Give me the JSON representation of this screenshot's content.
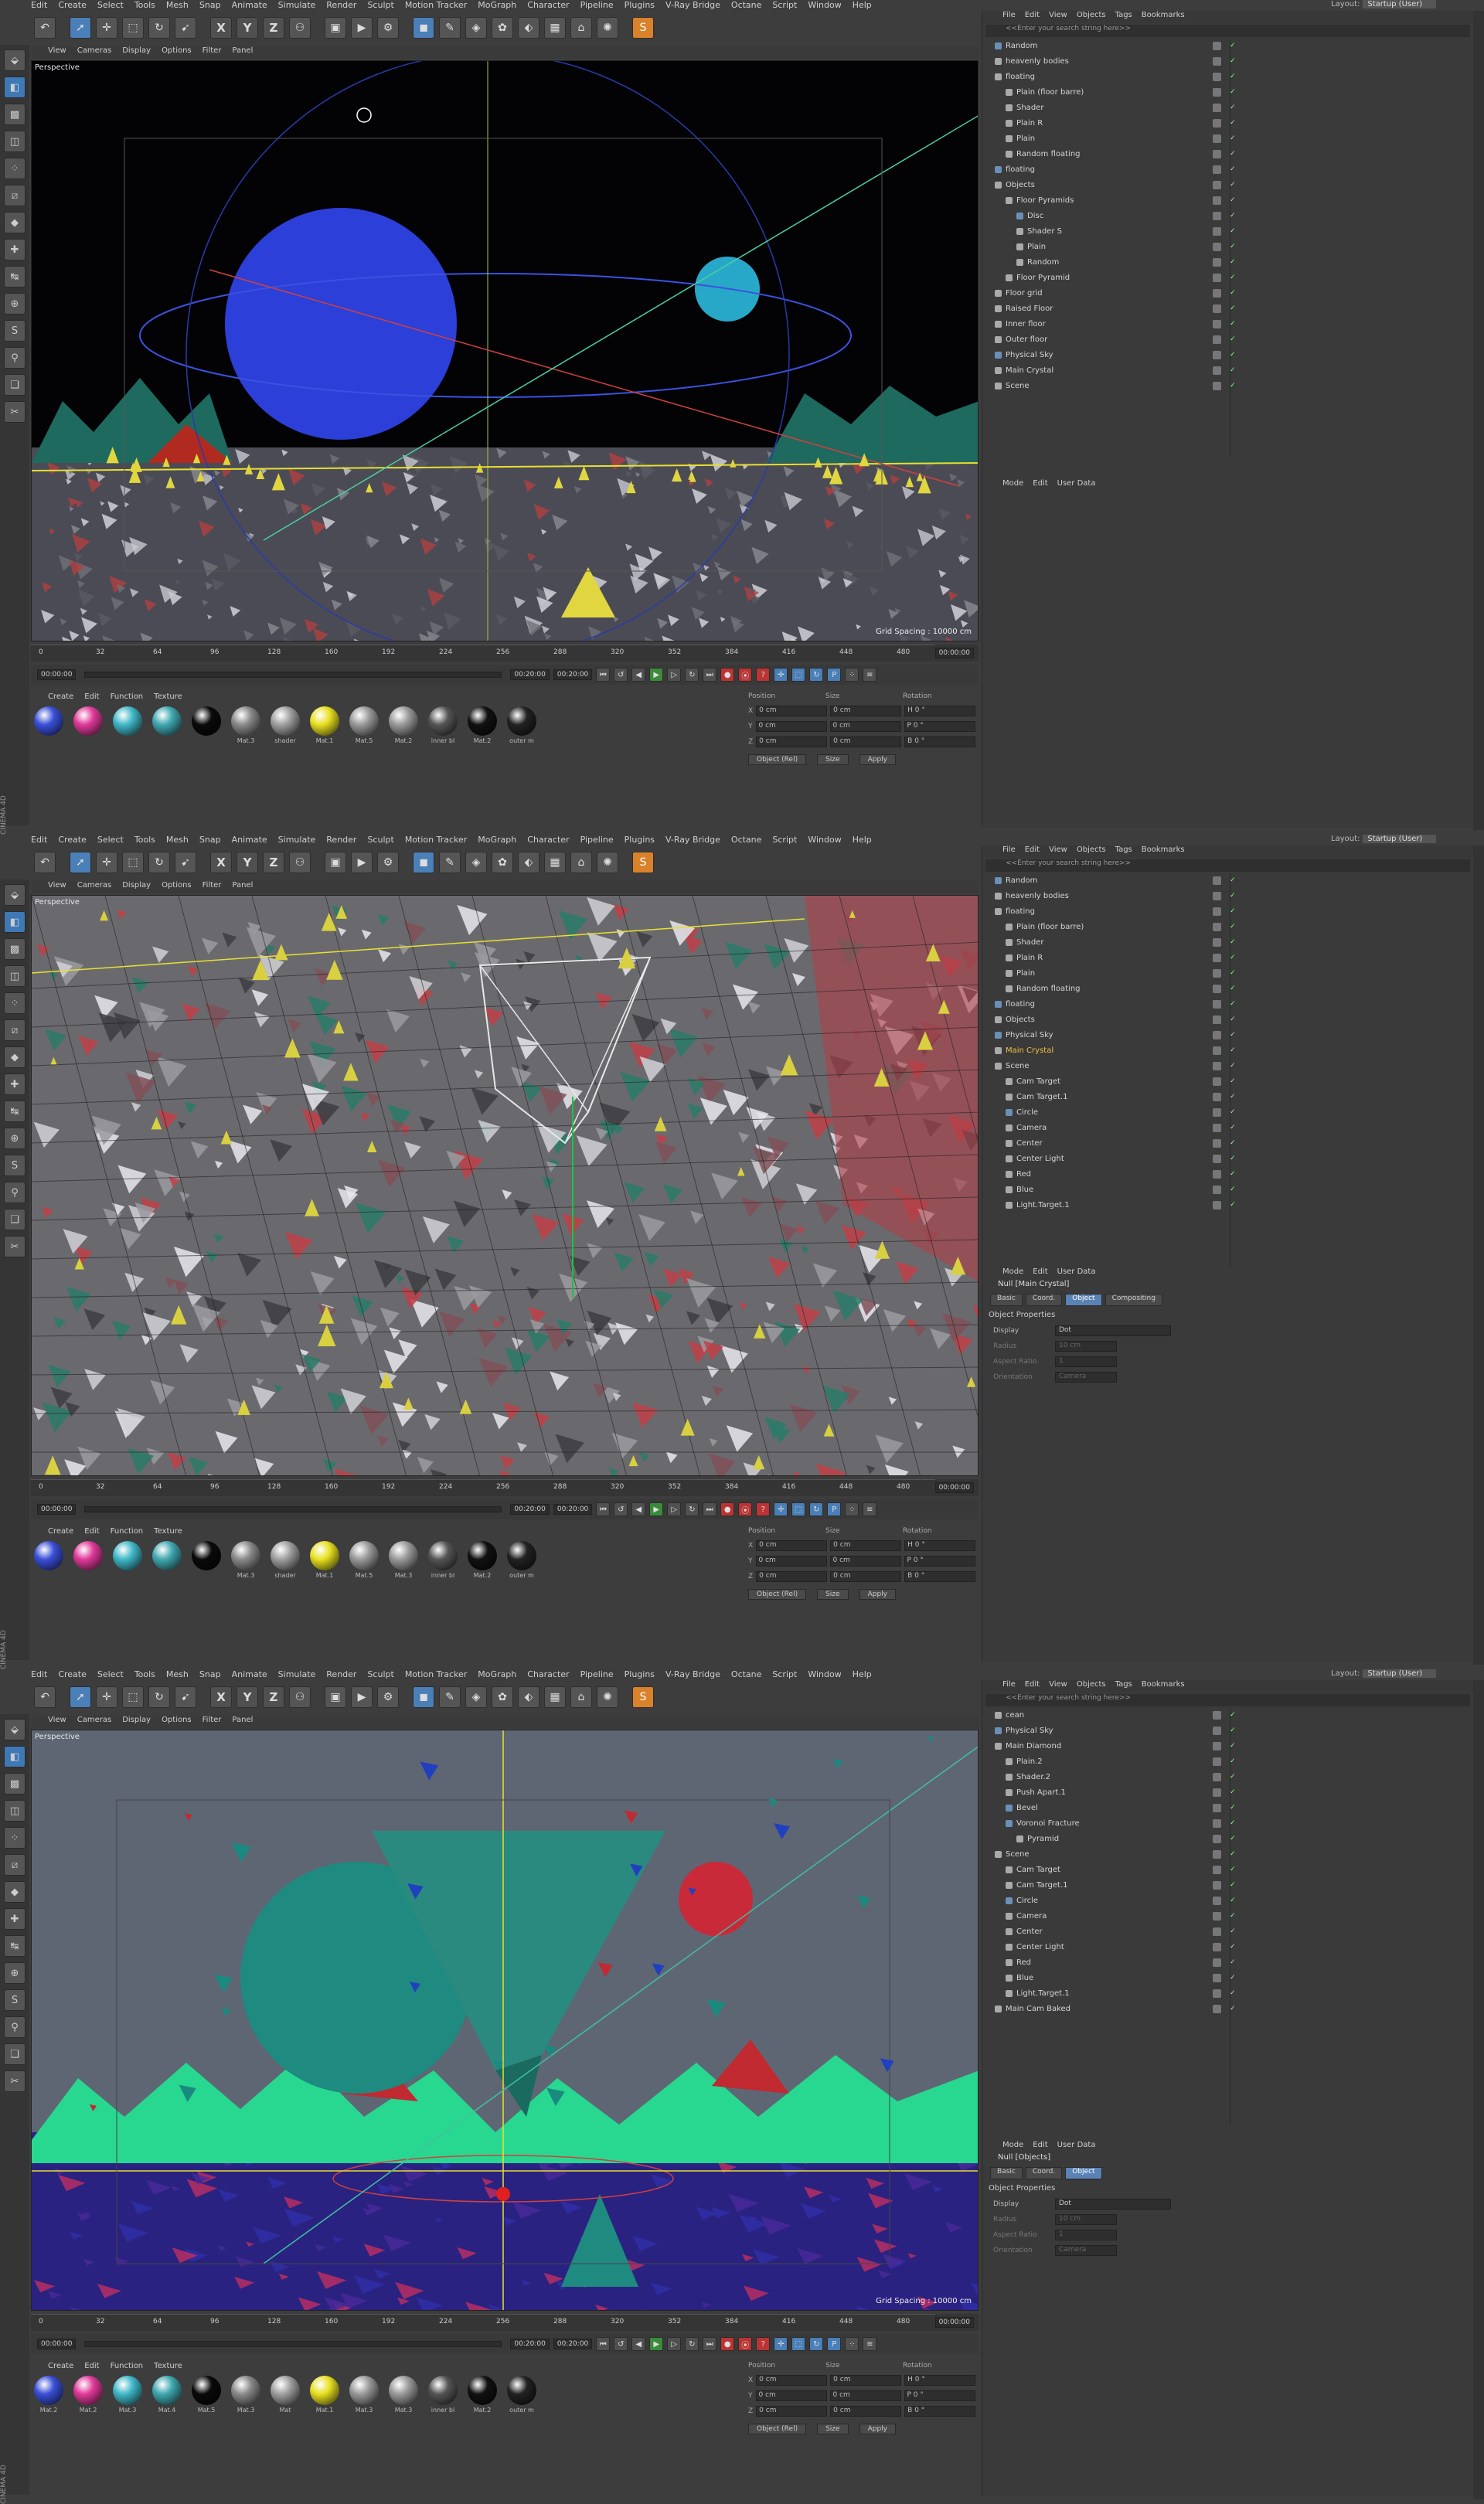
{
  "menu": [
    "Edit",
    "Create",
    "Select",
    "Tools",
    "Mesh",
    "Snap",
    "Animate",
    "Simulate",
    "Render",
    "Sculpt",
    "Motion Tracker",
    "MoGraph",
    "Character",
    "Pipeline",
    "Plugins",
    "V-Ray Bridge",
    "Octane",
    "Script",
    "Window",
    "Help"
  ],
  "layout_label": "Layout:",
  "layout_value": "Startup (User)",
  "viewport_menu": [
    "View",
    "Cameras",
    "Display",
    "Options",
    "Filter",
    "Panel"
  ],
  "viewport_label": "Perspective",
  "grid_spacing": "Grid Spacing : 10000 cm",
  "ticks": [
    "0",
    "32",
    "64",
    "96",
    "128",
    "160",
    "192",
    "224",
    "256",
    "288",
    "320",
    "352",
    "384",
    "416",
    "448",
    "480"
  ],
  "frame_end_label": "00:00:00",
  "time_start": "00:00:00",
  "time_end": "00:20:00",
  "time_end2": "00:20:00",
  "material_menu": [
    "Create",
    "Edit",
    "Function",
    "Texture"
  ],
  "coord_headers": [
    "Position",
    "Size",
    "Rotation"
  ],
  "coords": {
    "x": [
      "0 cm",
      "0 cm",
      "H 0 °"
    ],
    "y": [
      "0 cm",
      "0 cm",
      "P 0 °"
    ],
    "z": [
      "0 cm",
      "0 cm",
      "B 0 °"
    ],
    "buttons": [
      "Object (Rel)",
      "Size",
      "Apply"
    ]
  },
  "om_menu": [
    "File",
    "Edit",
    "View",
    "Objects",
    "Tags",
    "Bookmarks"
  ],
  "om_search": "<<Enter your search string here>>",
  "attr_menu": [
    "Mode",
    "Edit",
    "User Data"
  ],
  "attr_tabs": [
    "Basic",
    "Coord.",
    "Object",
    "Compositing"
  ],
  "attr_section": "Object Properties",
  "attr_props": [
    {
      "label": "Display",
      "value": "Dot"
    },
    {
      "label": "Radius",
      "value": "10 cm"
    },
    {
      "label": "Aspect Ratio",
      "value": "1"
    },
    {
      "label": "Orientation",
      "value": "Camera"
    }
  ],
  "brand": "CINEMA 4D",
  "panels": [
    {
      "materials": [
        {
          "label": "",
          "color": "#3a4fd8"
        },
        {
          "label": "",
          "color": "#e03a9a"
        },
        {
          "label": "",
          "color": "#40b8c8"
        },
        {
          "label": "",
          "color": "#40a8b0"
        },
        {
          "label": "",
          "color": "#0a0a0a"
        },
        {
          "label": "Mat.3",
          "color": "#8a8a8a"
        },
        {
          "label": "shader",
          "color": "#a0a0a0"
        },
        {
          "label": "Mat.1",
          "color": "#e8e020"
        },
        {
          "label": "Mat.5",
          "color": "#9a9a9a"
        },
        {
          "label": "Mat.2",
          "color": "#9a9a9a"
        },
        {
          "label": "inner bl",
          "color": "#555"
        },
        {
          "label": "Mat.2",
          "color": "#111"
        },
        {
          "label": "outer m",
          "color": "#222"
        }
      ],
      "objects": [
        {
          "name": "Random",
          "indent": 0,
          "color": "#6a8fb8"
        },
        {
          "name": "heavenly bodies",
          "indent": 0,
          "color": "#aaa"
        },
        {
          "name": "floating",
          "indent": 0,
          "color": "#aaa"
        },
        {
          "name": "Plain (floor barre)",
          "indent": 1,
          "color": "#aaa"
        },
        {
          "name": "Shader",
          "indent": 1,
          "color": "#aaa"
        },
        {
          "name": "Plain R",
          "indent": 1,
          "color": "#aaa"
        },
        {
          "name": "Plain",
          "indent": 1,
          "color": "#aaa"
        },
        {
          "name": "Random floating",
          "indent": 1,
          "color": "#aaa"
        },
        {
          "name": "floating",
          "indent": 0,
          "color": "#6a8fb8"
        },
        {
          "name": "Objects",
          "indent": 0,
          "color": "#aaa"
        },
        {
          "name": "Floor Pyramids",
          "indent": 1,
          "color": "#aaa"
        },
        {
          "name": "Disc",
          "indent": 2,
          "color": "#6a8fb8"
        },
        {
          "name": "Shader S",
          "indent": 2,
          "color": "#aaa"
        },
        {
          "name": "Plain",
          "indent": 2,
          "color": "#aaa"
        },
        {
          "name": "Random",
          "indent": 2,
          "color": "#aaa"
        },
        {
          "name": "Floor Pyramid",
          "indent": 1,
          "color": "#aaa"
        },
        {
          "name": "Floor grid",
          "indent": 0,
          "color": "#aaa"
        },
        {
          "name": "Raised Floor",
          "indent": 0,
          "color": "#aaa"
        },
        {
          "name": "Inner floor",
          "indent": 0,
          "color": "#aaa"
        },
        {
          "name": "Outer floor",
          "indent": 0,
          "color": "#aaa"
        },
        {
          "name": "Physical Sky",
          "indent": 0,
          "color": "#6a8fb8"
        },
        {
          "name": "Main Crystal",
          "indent": 0,
          "color": "#aaa"
        },
        {
          "name": "Scene",
          "indent": 0,
          "color": "#aaa"
        }
      ],
      "attr_title": "",
      "show_props": false
    },
    {
      "materials": [
        {
          "label": "",
          "color": "#3a4fd8"
        },
        {
          "label": "",
          "color": "#e03a9a"
        },
        {
          "label": "",
          "color": "#40b8c8"
        },
        {
          "label": "",
          "color": "#40a8b0"
        },
        {
          "label": "",
          "color": "#0a0a0a"
        },
        {
          "label": "Mat.3",
          "color": "#8a8a8a"
        },
        {
          "label": "shader",
          "color": "#a0a0a0"
        },
        {
          "label": "Mat.1",
          "color": "#e8e020"
        },
        {
          "label": "Mat.5",
          "color": "#9a9a9a"
        },
        {
          "label": "Mat.3",
          "color": "#9a9a9a"
        },
        {
          "label": "inner bl",
          "color": "#555"
        },
        {
          "label": "Mat.2",
          "color": "#111"
        },
        {
          "label": "outer m",
          "color": "#222"
        }
      ],
      "objects": [
        {
          "name": "Random",
          "indent": 0,
          "color": "#6a8fb8"
        },
        {
          "name": "heavenly bodies",
          "indent": 0,
          "color": "#aaa"
        },
        {
          "name": "floating",
          "indent": 0,
          "color": "#aaa"
        },
        {
          "name": "Plain (floor barre)",
          "indent": 1,
          "color": "#aaa"
        },
        {
          "name": "Shader",
          "indent": 1,
          "color": "#aaa"
        },
        {
          "name": "Plain R",
          "indent": 1,
          "color": "#aaa"
        },
        {
          "name": "Plain",
          "indent": 1,
          "color": "#aaa"
        },
        {
          "name": "Random floating",
          "indent": 1,
          "color": "#aaa"
        },
        {
          "name": "floating",
          "indent": 0,
          "color": "#6a8fb8"
        },
        {
          "name": "Objects",
          "indent": 0,
          "color": "#aaa"
        },
        {
          "name": "Physical Sky",
          "indent": 0,
          "color": "#6a8fb8"
        },
        {
          "name": "Main Crystal",
          "indent": 0,
          "color": "#aaa",
          "hl": true
        },
        {
          "name": "Scene",
          "indent": 0,
          "color": "#aaa"
        },
        {
          "name": "Cam Target",
          "indent": 1,
          "color": "#aaa"
        },
        {
          "name": "Cam Target.1",
          "indent": 1,
          "color": "#aaa"
        },
        {
          "name": "Circle",
          "indent": 1,
          "color": "#6a8fb8"
        },
        {
          "name": "Camera",
          "indent": 1,
          "color": "#aaa"
        },
        {
          "name": "Center",
          "indent": 1,
          "color": "#aaa"
        },
        {
          "name": "Center Light",
          "indent": 1,
          "color": "#aaa"
        },
        {
          "name": "Red",
          "indent": 1,
          "color": "#aaa"
        },
        {
          "name": "Blue",
          "indent": 1,
          "color": "#aaa"
        },
        {
          "name": "Light.Target.1",
          "indent": 1,
          "color": "#aaa"
        }
      ],
      "attr_title": "Null [Main Crystal]",
      "show_props": true
    },
    {
      "materials": [
        {
          "label": "Mat.2",
          "color": "#3a4fd8"
        },
        {
          "label": "Mat.2",
          "color": "#e03a9a"
        },
        {
          "label": "Mat.3",
          "color": "#40b8c8"
        },
        {
          "label": "Mat.4",
          "color": "#40a8b0"
        },
        {
          "label": "Mat.5",
          "color": "#0a0a0a"
        },
        {
          "label": "Mat.3",
          "color": "#8a8a8a"
        },
        {
          "label": "Mat",
          "color": "#a0a0a0"
        },
        {
          "label": "Mat.1",
          "color": "#e8e020"
        },
        {
          "label": "Mat.3",
          "color": "#9a9a9a"
        },
        {
          "label": "Mat.3",
          "color": "#9a9a9a"
        },
        {
          "label": "inner bl",
          "color": "#555"
        },
        {
          "label": "Mat.2",
          "color": "#111"
        },
        {
          "label": "outer m",
          "color": "#222"
        }
      ],
      "objects": [
        {
          "name": "cean",
          "indent": 0,
          "color": "#aaa"
        },
        {
          "name": "Physical Sky",
          "indent": 0,
          "color": "#6a8fb8"
        },
        {
          "name": "Main Diamond",
          "indent": 0,
          "color": "#aaa"
        },
        {
          "name": "Plain.2",
          "indent": 1,
          "color": "#aaa"
        },
        {
          "name": "Shader.2",
          "indent": 1,
          "color": "#aaa"
        },
        {
          "name": "Push Apart.1",
          "indent": 1,
          "color": "#aaa"
        },
        {
          "name": "Bevel",
          "indent": 1,
          "color": "#6a8fb8"
        },
        {
          "name": "Voronoi Fracture",
          "indent": 1,
          "color": "#6a8fb8"
        },
        {
          "name": "Pyramid",
          "indent": 2,
          "color": "#aaa"
        },
        {
          "name": "Scene",
          "indent": 0,
          "color": "#aaa"
        },
        {
          "name": "Cam Target",
          "indent": 1,
          "color": "#aaa"
        },
        {
          "name": "Cam Target.1",
          "indent": 1,
          "color": "#aaa"
        },
        {
          "name": "Circle",
          "indent": 1,
          "color": "#6a8fb8"
        },
        {
          "name": "Camera",
          "indent": 1,
          "color": "#aaa"
        },
        {
          "name": "Center",
          "indent": 1,
          "color": "#aaa"
        },
        {
          "name": "Center Light",
          "indent": 1,
          "color": "#aaa"
        },
        {
          "name": "Red",
          "indent": 1,
          "color": "#aaa"
        },
        {
          "name": "Blue",
          "indent": 1,
          "color": "#aaa"
        },
        {
          "name": "Light.Target.1",
          "indent": 1,
          "color": "#aaa"
        },
        {
          "name": "Main Cam Baked",
          "indent": 0,
          "color": "#aaa"
        }
      ],
      "attr_title": "Null [Objects]",
      "show_props": true
    }
  ]
}
